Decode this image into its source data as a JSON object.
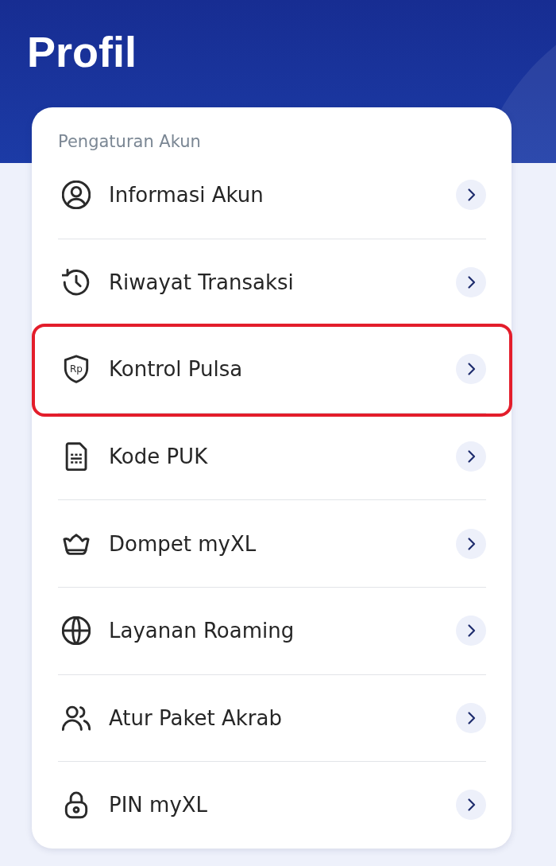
{
  "header": {
    "title": "Profil"
  },
  "section": {
    "title": "Pengaturan Akun"
  },
  "items": [
    {
      "label": "Informasi Akun",
      "highlighted": false
    },
    {
      "label": "Riwayat Transaksi",
      "highlighted": false
    },
    {
      "label": "Kontrol Pulsa",
      "icon_label": "Rp",
      "highlighted": true
    },
    {
      "label": "Kode PUK",
      "highlighted": false
    },
    {
      "label": "Dompet myXL",
      "highlighted": false
    },
    {
      "label": "Layanan Roaming",
      "highlighted": false
    },
    {
      "label": "Atur Paket Akrab",
      "highlighted": false
    },
    {
      "label": "PIN myXL",
      "highlighted": false
    }
  ]
}
